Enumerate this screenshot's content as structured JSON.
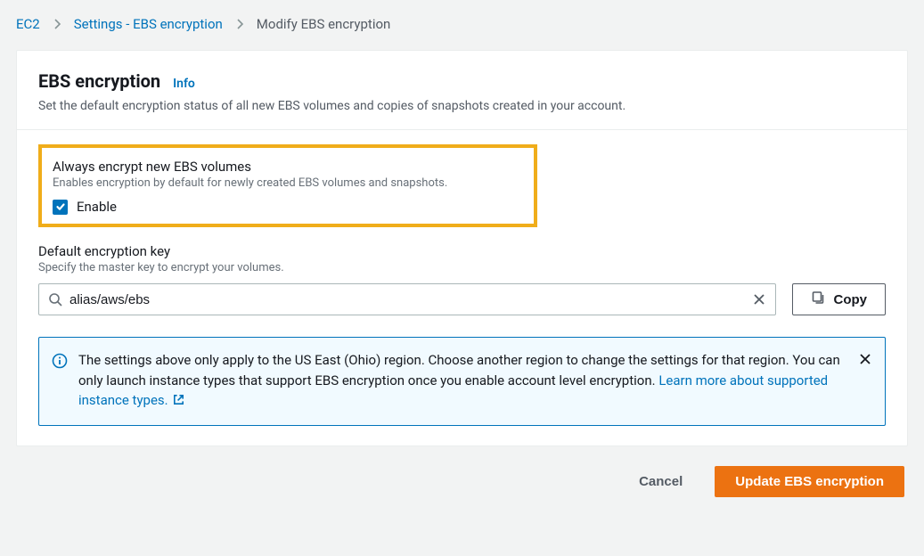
{
  "breadcrumb": {
    "ec2": "EC2",
    "settings": "Settings - EBS encryption",
    "current": "Modify EBS encryption"
  },
  "panel": {
    "title": "EBS encryption",
    "info": "Info",
    "description": "Set the default encryption status of all new EBS volumes and copies of snapshots created in your account."
  },
  "always_encrypt": {
    "title": "Always encrypt new EBS volumes",
    "description": "Enables encryption by default for newly created EBS volumes and snapshots.",
    "checkbox_label": "Enable",
    "checked": true
  },
  "default_key": {
    "title": "Default encryption key",
    "description": "Specify the master key to encrypt your volumes.",
    "value": "alias/aws/ebs",
    "copy_label": "Copy"
  },
  "banner": {
    "text_pre": "The settings above only apply to the US East (Ohio) region. Choose another region to change the settings for that region. You can only launch instance types that support EBS encryption once you enable account level encryption. ",
    "link": "Learn more about supported instance types."
  },
  "actions": {
    "cancel": "Cancel",
    "update": "Update EBS encryption"
  }
}
